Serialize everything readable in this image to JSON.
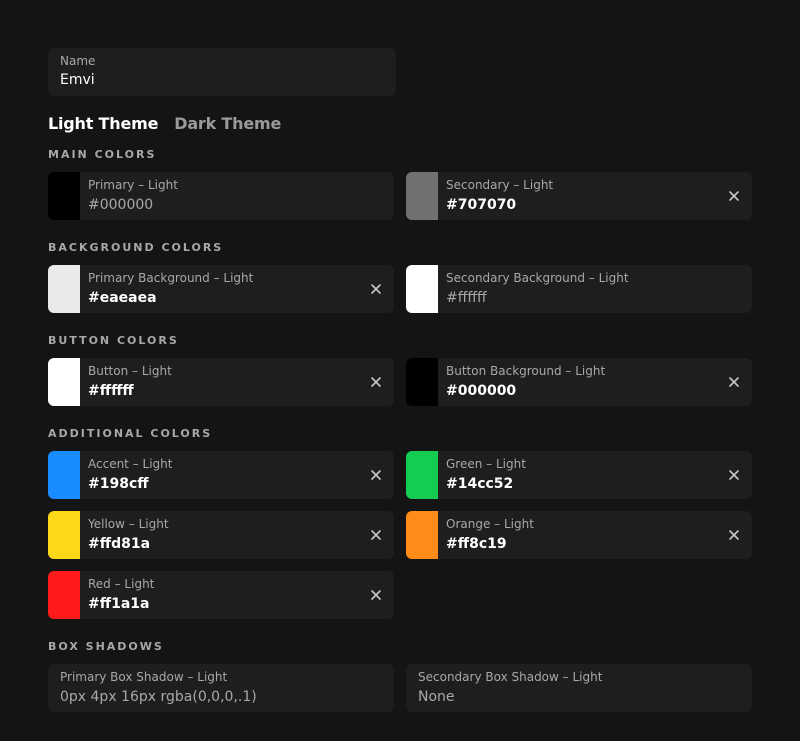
{
  "name_field": {
    "label": "Name",
    "value": "Emvi"
  },
  "tabs": [
    {
      "label": "Light Theme",
      "active": true
    },
    {
      "label": "Dark Theme",
      "active": false
    }
  ],
  "sections": {
    "main": {
      "title": "MAIN COLORS",
      "items": [
        {
          "label": "Primary – Light",
          "value": "#000000",
          "swatch": "#000000",
          "placeholder": true,
          "clearable": false
        },
        {
          "label": "Secondary – Light",
          "value": "#707070",
          "swatch": "#707070",
          "placeholder": false,
          "clearable": true
        }
      ]
    },
    "background": {
      "title": "BACKGROUND COLORS",
      "items": [
        {
          "label": "Primary Background – Light",
          "value": "#eaeaea",
          "swatch": "#eaeaea",
          "placeholder": false,
          "clearable": true
        },
        {
          "label": "Secondary Background – Light",
          "value": "#ffffff",
          "swatch": "#ffffff",
          "placeholder": true,
          "clearable": false
        }
      ]
    },
    "button": {
      "title": "BUTTON COLORS",
      "items": [
        {
          "label": "Button – Light",
          "value": "#ffffff",
          "swatch": "#ffffff",
          "placeholder": false,
          "clearable": true
        },
        {
          "label": "Button Background – Light",
          "value": "#000000",
          "swatch": "#000000",
          "placeholder": false,
          "clearable": true
        }
      ]
    },
    "additional": {
      "title": "ADDITIONAL COLORS",
      "items": [
        {
          "label": "Accent – Light",
          "value": "#198cff",
          "swatch": "#198cff",
          "placeholder": false,
          "clearable": true
        },
        {
          "label": "Green – Light",
          "value": "#14cc52",
          "swatch": "#14cc52",
          "placeholder": false,
          "clearable": true
        },
        {
          "label": "Yellow – Light",
          "value": "#ffd81a",
          "swatch": "#ffd81a",
          "placeholder": false,
          "clearable": true
        },
        {
          "label": "Orange – Light",
          "value": "#ff8c19",
          "swatch": "#ff8c19",
          "placeholder": false,
          "clearable": true
        },
        {
          "label": "Red – Light",
          "value": "#ff1a1a",
          "swatch": "#ff1a1a",
          "placeholder": false,
          "clearable": true
        }
      ]
    },
    "shadows": {
      "title": "BOX SHADOWS",
      "items": [
        {
          "label": "Primary Box Shadow – Light",
          "value": "0px 4px 16px rgba(0,0,0,.1)"
        },
        {
          "label": "Secondary Box Shadow – Light",
          "value": "None"
        }
      ]
    }
  },
  "icons": {
    "clear": "close-icon"
  }
}
